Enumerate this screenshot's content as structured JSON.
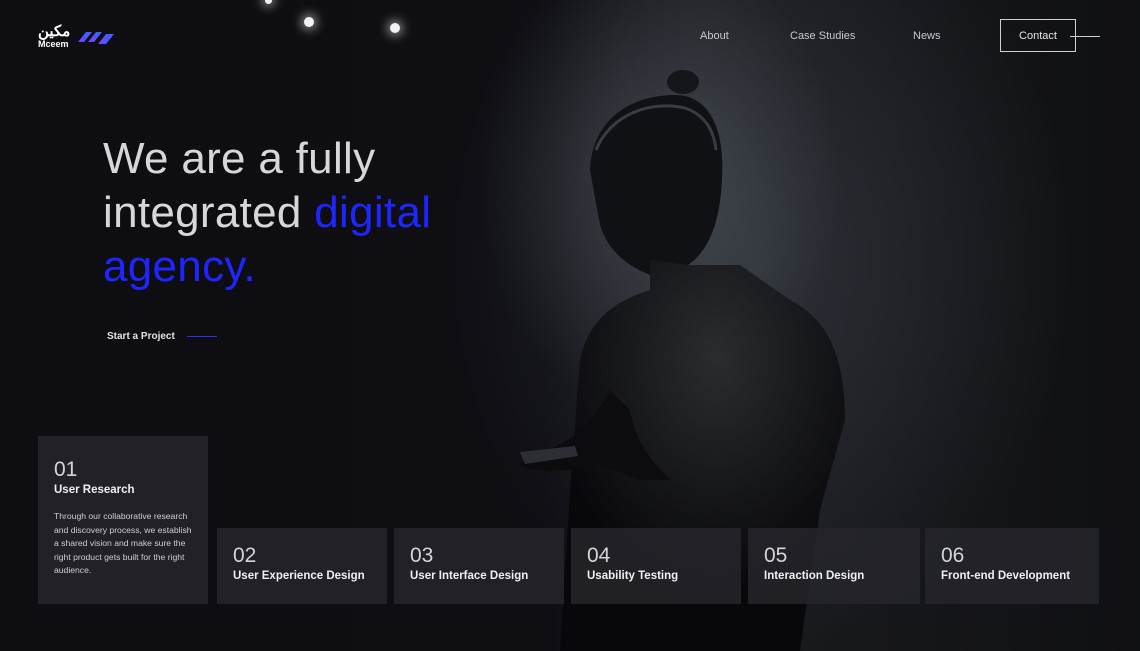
{
  "brand": {
    "name_ar": "مكين",
    "name_en": "Mceem",
    "accent_colors": [
      "#7b3cff",
      "#2b6bff"
    ]
  },
  "nav": {
    "links": [
      "About",
      "Case Studies",
      "News"
    ],
    "contact_label": "Contact"
  },
  "hero": {
    "line1": "We are a fully",
    "line2_plain": "integrated ",
    "line2_accent": "digital",
    "line3_accent": "agency.",
    "accent_color": "#1f25ff",
    "cta_label": "Start a Project"
  },
  "services": [
    {
      "num": "01",
      "title": "User Research",
      "desc": "Through our collaborative research and discovery process, we establish a shared vision and make sure the right product gets built for the right audience."
    },
    {
      "num": "02",
      "title": "User Experience Design"
    },
    {
      "num": "03",
      "title": "User Interface Design"
    },
    {
      "num": "04",
      "title": "Usability Testing"
    },
    {
      "num": "05",
      "title": "Interaction Design"
    },
    {
      "num": "06",
      "title": "Front-end Development"
    }
  ]
}
